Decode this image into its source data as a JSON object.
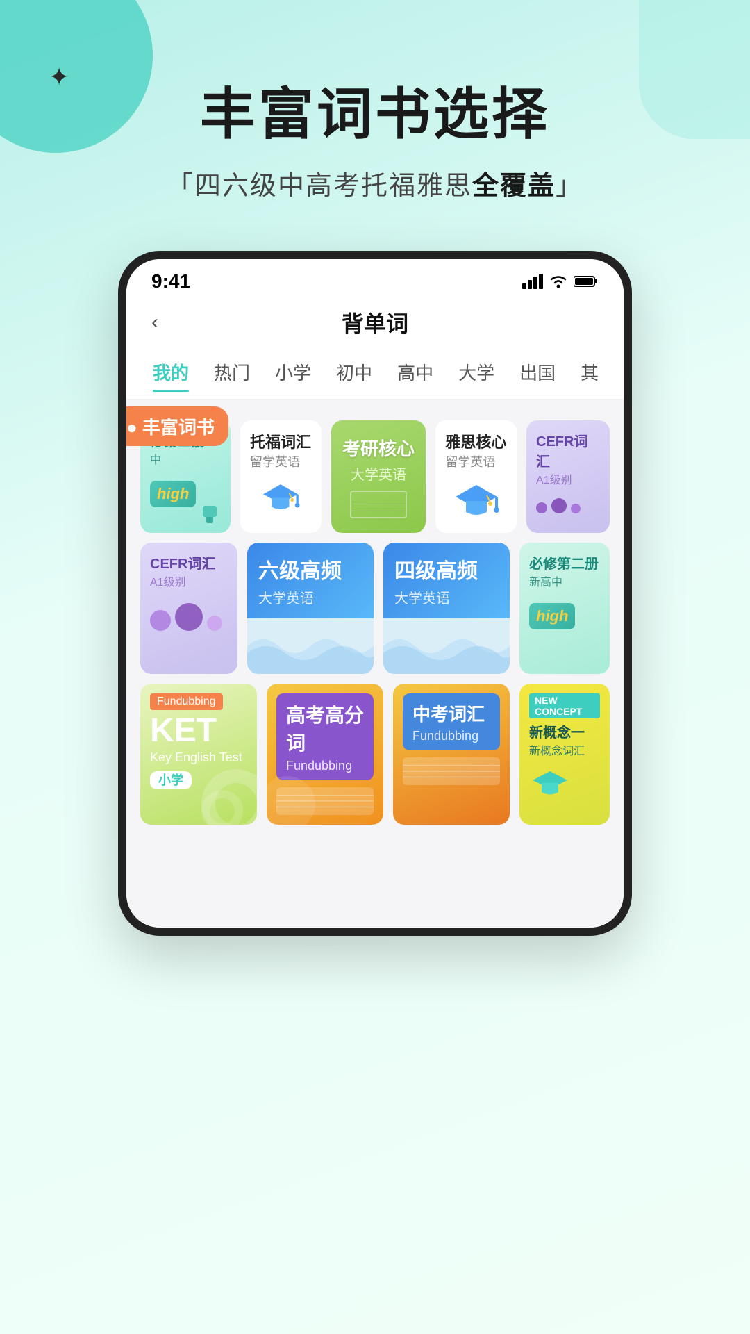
{
  "background": {
    "gradient_start": "#b8f0e8",
    "gradient_end": "#f0fff8"
  },
  "top_section": {
    "sparkle": "✦",
    "main_title": "丰富词书选择",
    "sub_title_prefix": "「四六级中高考托福雅思",
    "sub_title_strong": "全覆盖",
    "sub_title_suffix": "」"
  },
  "status_bar": {
    "time": "9:41",
    "signal": "▲▲▲",
    "wifi": "WiFi",
    "battery": "Battery"
  },
  "app_header": {
    "back": "‹",
    "title": "背单词"
  },
  "category_tabs": [
    {
      "label": "我的",
      "active": true
    },
    {
      "label": "热门",
      "active": false
    },
    {
      "label": "小学",
      "active": false
    },
    {
      "label": "初中",
      "active": false
    },
    {
      "label": "高中",
      "active": false
    },
    {
      "label": "大学",
      "active": false
    },
    {
      "label": "出国",
      "active": false
    },
    {
      "label": "其",
      "active": false
    }
  ],
  "rich_badge": "● 丰富词书",
  "book_rows": {
    "row1": [
      {
        "id": "partial_left",
        "title": "修第二册",
        "sub": "中",
        "type": "partial_left"
      },
      {
        "id": "toefl",
        "title": "托福词汇",
        "sub": "留学英语",
        "type": "grad_blue"
      },
      {
        "id": "kaoyan",
        "title": "考研核心",
        "sub": "大学英语",
        "type": "featured_green"
      },
      {
        "id": "ielts",
        "title": "雅思核心",
        "sub": "留学英语",
        "type": "grad_blue"
      },
      {
        "id": "cefr",
        "title": "CEFR词汇",
        "sub": "A1级别",
        "type": "partial_right"
      }
    ],
    "row2": [
      {
        "id": "cefr2",
        "title": "CEFR词汇",
        "sub": "A1级别",
        "type": "partial_left_purple"
      },
      {
        "id": "liuji",
        "title": "六级高频",
        "sub": "大学英语",
        "type": "blue_wave"
      },
      {
        "id": "siji",
        "title": "四级高频",
        "sub": "大学英语",
        "type": "blue_wave"
      },
      {
        "id": "bixiu",
        "title": "必修第二册",
        "sub": "新高中",
        "type": "partial_right_green"
      }
    ],
    "row3": [
      {
        "id": "ket",
        "title": "KET",
        "sub": "Key English Test",
        "level": "小学",
        "type": "ket"
      },
      {
        "id": "gaokao_high",
        "title": "高考高分词",
        "sub": "Fundubbing",
        "type": "gaokao"
      },
      {
        "id": "zhongkao",
        "title": "中考词汇",
        "sub": "Fundubbing",
        "type": "zhongkao"
      },
      {
        "id": "xingainian",
        "title": "新概念一",
        "sub": "新概念词汇",
        "type": "partial_right_yellow"
      }
    ]
  }
}
